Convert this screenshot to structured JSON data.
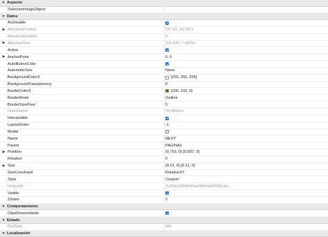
{
  "sections": [
    {
      "title": "Aspecto",
      "expanded": true,
      "rows": [
        {
          "name": "SelectionImageObject",
          "value": "",
          "type": "text",
          "expandable": false,
          "dim": false
        }
      ]
    },
    {
      "title": "Datos",
      "expanded": true,
      "rows": [
        {
          "name": "Archivable",
          "value": "",
          "type": "check",
          "checked": true,
          "expandable": false,
          "dim": false
        },
        {
          "name": "AbsolutePosition",
          "value": "527.42, 69.7873",
          "type": "text",
          "expandable": true,
          "dim": true
        },
        {
          "name": "AbsoluteRotation",
          "value": "0",
          "type": "text",
          "expandable": false,
          "dim": true
        },
        {
          "name": "AbsoluteSize",
          "value": "155.632, 7.49251",
          "type": "text",
          "expandable": true,
          "dim": true
        },
        {
          "name": "Active",
          "value": "",
          "type": "check",
          "checked": true,
          "expandable": false,
          "dim": false
        },
        {
          "name": "AnchorPoint",
          "value": "0, 0",
          "type": "text",
          "expandable": true,
          "dim": false
        },
        {
          "name": "AutoButtonColor",
          "value": "",
          "type": "check",
          "checked": true,
          "expandable": false,
          "dim": false
        },
        {
          "name": "AutomaticSize",
          "value": "None",
          "type": "text",
          "expandable": false,
          "dim": false
        },
        {
          "name": "BackgroundColor3",
          "value": "[255, 255, 255]",
          "type": "color",
          "color": "#ffffff",
          "expandable": false,
          "dim": false
        },
        {
          "name": "BackgroundTransparency",
          "value": "0",
          "type": "text",
          "expandable": false,
          "dim": false
        },
        {
          "name": "BorderColor3",
          "value": "[106, 103, 5]",
          "type": "color",
          "color": "#6a6705",
          "expandable": false,
          "dim": false
        },
        {
          "name": "BorderMode",
          "value": "Outline",
          "type": "text",
          "expandable": false,
          "dim": false
        },
        {
          "name": "BorderSizePixel",
          "value": "5",
          "type": "text",
          "expandable": false,
          "dim": false
        },
        {
          "name": "ClassName",
          "value": "TextButton",
          "type": "text",
          "expandable": false,
          "dim": true
        },
        {
          "name": "Interactable",
          "value": "",
          "type": "check",
          "checked": true,
          "expandable": false,
          "dim": false
        },
        {
          "name": "LayoutOrder",
          "value": "-1",
          "type": "text",
          "expandable": false,
          "dim": false
        },
        {
          "name": "Modal",
          "value": "",
          "type": "check",
          "checked": false,
          "expandable": false,
          "dim": false
        },
        {
          "name": "Name",
          "value": "NEXT",
          "type": "text",
          "expandable": false,
          "dim": false
        },
        {
          "name": "Parent",
          "value": "PAGINA1",
          "type": "text",
          "expandable": false,
          "dim": false
        },
        {
          "name": "Position",
          "value": "{0.762, 0},{0.837, 0}",
          "type": "text",
          "expandable": true,
          "dim": false
        },
        {
          "name": "Rotation",
          "value": "0",
          "type": "text",
          "expandable": false,
          "dim": false
        },
        {
          "name": "Size",
          "value": "{0.21, 0},{0.11, 0}",
          "type": "text",
          "expandable": true,
          "dim": false
        },
        {
          "name": "SizeConstraint",
          "value": "RelativeXY",
          "type": "text",
          "expandable": false,
          "dim": false
        },
        {
          "name": "Style",
          "value": "Custom",
          "type": "text",
          "expandable": false,
          "dim": false
        },
        {
          "name": "UniqueId",
          "value": "7c200e199d0416af06fef3c0000bcba",
          "type": "text",
          "expandable": false,
          "dim": true
        },
        {
          "name": "Visible",
          "value": "",
          "type": "check",
          "checked": true,
          "expandable": false,
          "dim": false
        },
        {
          "name": "ZIndex",
          "value": "2",
          "type": "text",
          "expandable": false,
          "dim": false
        }
      ]
    },
    {
      "title": "Comportamiento",
      "expanded": true,
      "rows": [
        {
          "name": "ClipsDescendants",
          "value": "",
          "type": "check",
          "checked": true,
          "expandable": false,
          "dim": false
        }
      ]
    },
    {
      "title": "Estado",
      "expanded": true,
      "rows": [
        {
          "name": "GuiState",
          "value": "Idle",
          "type": "text",
          "expandable": false,
          "dim": true
        }
      ]
    },
    {
      "title": "Localización",
      "expanded": true,
      "rows": []
    }
  ],
  "colors": {
    "checkbox_on": "#1a73e8",
    "section_bg": "#e9e9e9"
  },
  "icons": {
    "section_toggle": "chevron-down-icon",
    "row_expander": "chevron-right-icon",
    "checkbox": "check-icon"
  }
}
